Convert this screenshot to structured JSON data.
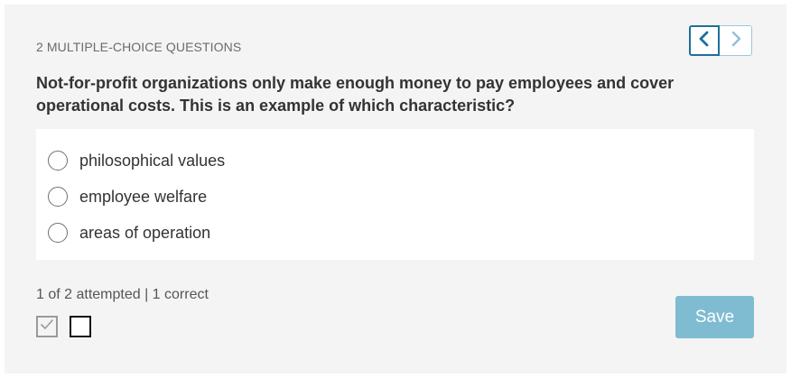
{
  "header": {
    "heading": "2 MULTIPLE-CHOICE QUESTIONS",
    "prev_icon": "chevron-left-icon",
    "next_icon": "chevron-right-icon"
  },
  "question": {
    "text": "Not-for-profit organizations only make enough money to pay employees and cover operational costs. This is an example of which characteristic?"
  },
  "options": [
    {
      "label": "philosophical values",
      "selected": false
    },
    {
      "label": "employee welfare",
      "selected": false
    },
    {
      "label": "areas of operation",
      "selected": false
    }
  ],
  "footer": {
    "progress_text": "1 of 2 attempted | 1 correct",
    "question_marks": [
      {
        "icon": "checkmark-icon",
        "state": "answered"
      },
      {
        "icon": "",
        "state": "current"
      }
    ],
    "save_label": "Save"
  },
  "colors": {
    "accent": "#1f6f9a",
    "save_button": "#7fbcd1",
    "panel_background": "#f4f4f4"
  }
}
